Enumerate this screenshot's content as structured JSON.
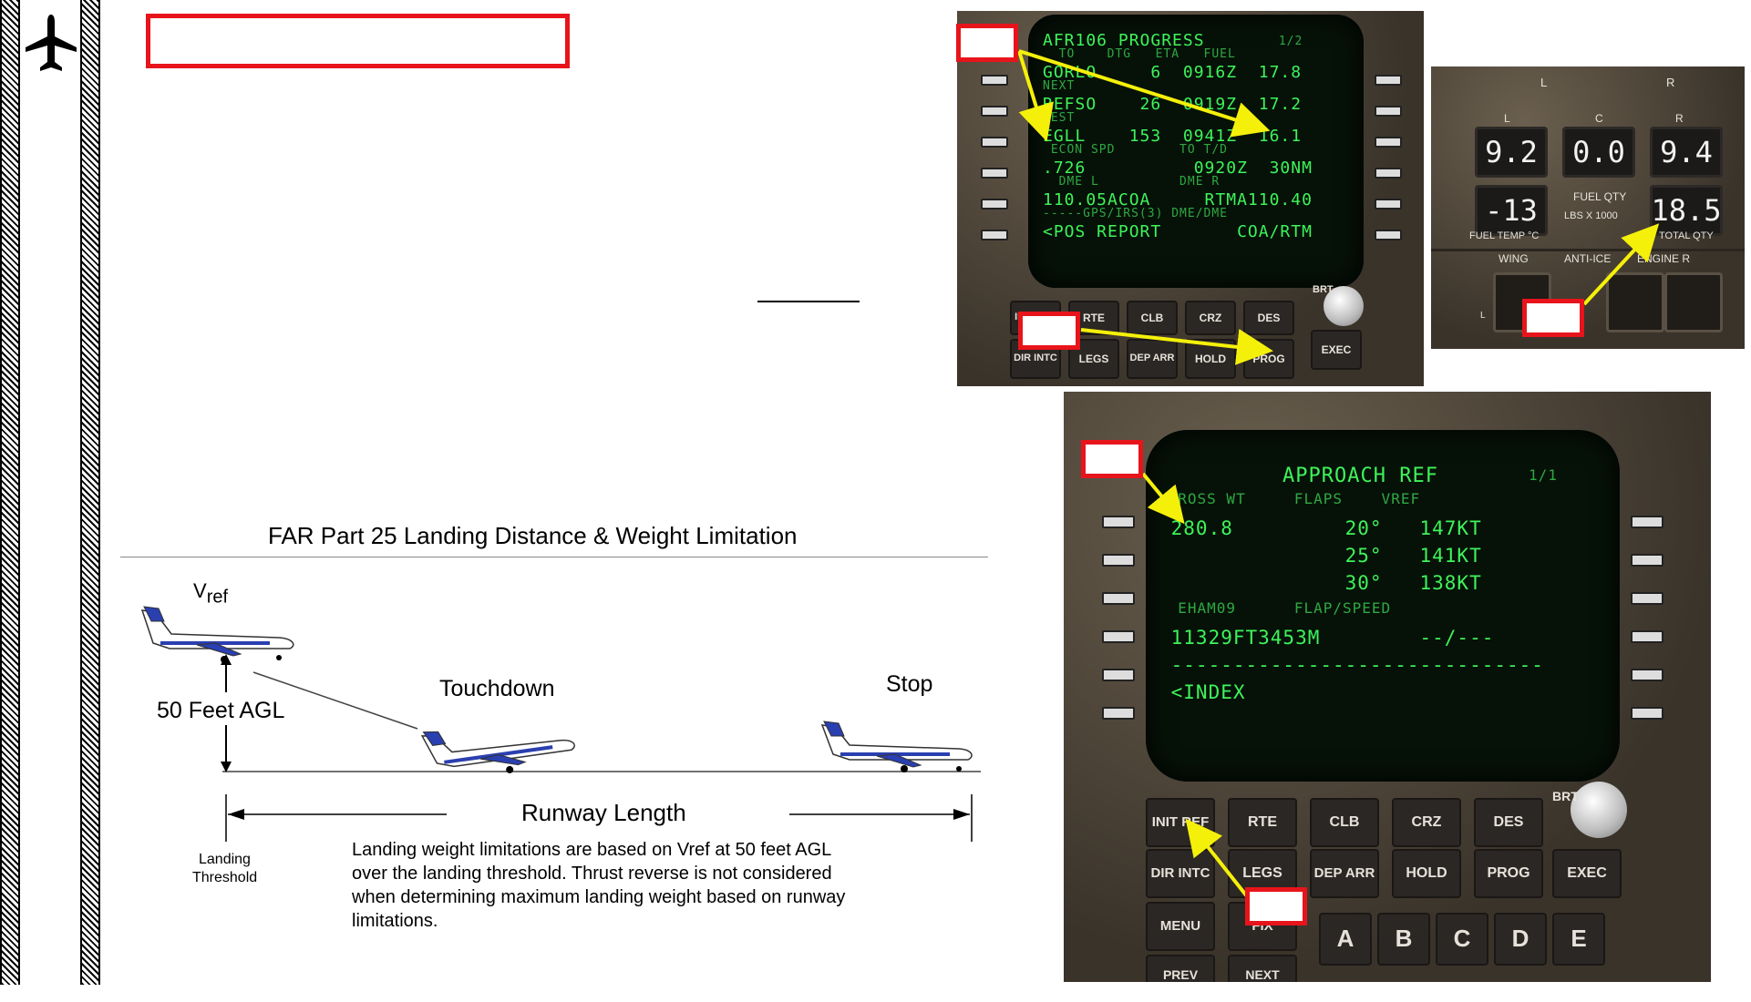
{
  "cdu_top": {
    "lines": [
      {
        "text": "AFR106 PROGRESS",
        "small": " 1/2"
      },
      {
        "text": "  TO    DTG   ETA   FUEL",
        "small_line": true
      },
      {
        "text": "GORLO     6  0916Z  17.8"
      },
      {
        "text": "NEXT",
        "small_line": true
      },
      {
        "text": "REFSO    26  0919Z  17.2"
      },
      {
        "text": "DEST",
        "small_line": true
      },
      {
        "text": "EGLL    153  0941Z  16.1"
      },
      {
        "text": " ECON SPD        TO T/D",
        "small_line": true
      },
      {
        "text": ".726          0920Z  30NM"
      },
      {
        "text": "  DME L          DME R",
        "small_line": true
      },
      {
        "text": "110.05ACOA     RTMA110.40"
      },
      {
        "text": "-----GPS/IRS(3) DME/DME",
        "small_line": true
      },
      {
        "text": "<POS REPORT       COA/RTM"
      }
    ],
    "keys": [
      {
        "label": "INIT REF"
      },
      {
        "label": "RTE"
      },
      {
        "label": "CLB"
      },
      {
        "label": "CRZ"
      },
      {
        "label": "DES"
      },
      {
        "label": "DIR INTC"
      },
      {
        "label": "LEGS"
      },
      {
        "label": "DEP ARR"
      },
      {
        "label": "HOLD"
      },
      {
        "label": "PROG"
      },
      {
        "label": "EXEC"
      }
    ],
    "brt": "BRT"
  },
  "fuel_panel": {
    "top_labels": [
      "L",
      "R"
    ],
    "col_labels": [
      "L",
      "C",
      "R"
    ],
    "displays": [
      "9.2",
      "0.0",
      "9.4",
      "-13",
      "18.5"
    ],
    "fuel_qty": "FUEL QTY",
    "units": "LBS   X 1000",
    "fuel_temp": "FUEL TEMP °C",
    "total_qty": "TOTAL QTY",
    "wing": "WING",
    "anti_ice": "ANTI-ICE",
    "engine": "ENGINE  R",
    "small_l": "L"
  },
  "cdu_bottom": {
    "title": "APPROACH REF",
    "page": "1/1",
    "lines": [
      {
        "text": " GROSS WT     FLAPS    VREF",
        "small_line": true
      },
      {
        "text": " 280.8         20°   147KT"
      },
      {
        "text": "               25°   141KT"
      },
      {
        "text": "               30°   138KT"
      },
      {
        "text": "  EHAM09      FLAP/SPEED",
        "small_line": true
      },
      {
        "text": " 11329FT3453M        --/---"
      },
      {
        "text": " ------------------------------"
      },
      {
        "text": " <INDEX"
      }
    ],
    "keys": [
      {
        "label": "INIT REF"
      },
      {
        "label": "RTE"
      },
      {
        "label": "CLB"
      },
      {
        "label": "CRZ"
      },
      {
        "label": "DES"
      },
      {
        "label": "DIR INTC"
      },
      {
        "label": "LEGS"
      },
      {
        "label": "DEP ARR"
      },
      {
        "label": "HOLD"
      },
      {
        "label": "PROG"
      },
      {
        "label": "EXEC"
      },
      {
        "label": "MENU"
      },
      {
        "label": "FIX"
      },
      {
        "label": "A"
      },
      {
        "label": "B"
      },
      {
        "label": "C"
      },
      {
        "label": "D"
      },
      {
        "label": "E"
      },
      {
        "label": "PREV"
      },
      {
        "label": "NEXT"
      }
    ],
    "brt": "BRT"
  },
  "diagram": {
    "title": "FAR Part 25 Landing Distance & Weight Limitation",
    "vref": "V",
    "vref_sub": "ref",
    "agl": "50 Feet AGL",
    "touchdown": "Touchdown",
    "stop": "Stop",
    "runway_length": "Runway Length",
    "landing_threshold_1": "Landing",
    "landing_threshold_2": "Threshold",
    "caption_1": "Landing weight limitations are based on Vref at 50 feet AGL",
    "caption_2": "over the landing threshold.   Thrust reverse is not considered",
    "caption_3": "when determining maximum landing weight based on runway",
    "caption_4": "limitations."
  },
  "colors": {
    "marker_red": "#e8141b",
    "arrow_yellow": "#f5f00a",
    "cdu_green": "#3ef35a"
  },
  "icons": [
    "airplane-icon"
  ]
}
